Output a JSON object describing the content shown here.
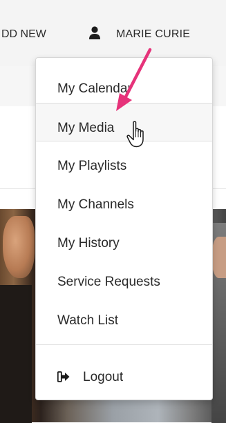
{
  "topbar": {
    "add_new_label": "DD NEW",
    "user_name": "MARIE CURIE",
    "user_icon": "user-icon"
  },
  "menu": {
    "items": [
      {
        "label": "My Calendar"
      },
      {
        "label": "My Media"
      },
      {
        "label": "My Playlists"
      },
      {
        "label": "My Channels"
      },
      {
        "label": "My History"
      },
      {
        "label": "Service Requests"
      },
      {
        "label": "Watch List"
      }
    ],
    "highlighted_item": "My Media",
    "logout": {
      "label": "Logout",
      "icon": "logout-icon"
    }
  },
  "annotation": {
    "arrow_color": "#e6337a",
    "arrow_icon": "pointer-arrow-icon"
  },
  "cursor_icon": "hand-pointer-cursor-icon"
}
